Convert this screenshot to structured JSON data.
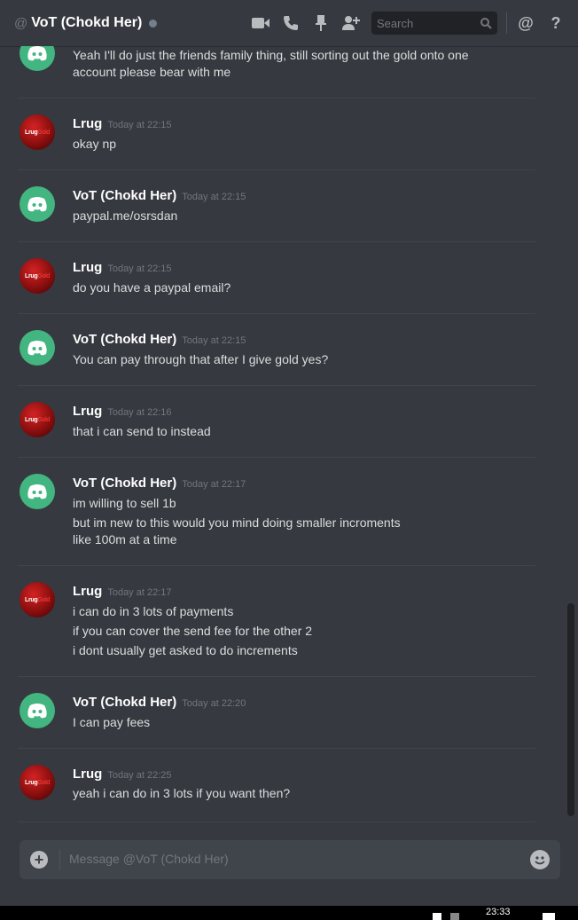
{
  "header": {
    "at_symbol": "@",
    "channel_name": "VoT (Chokd Her)",
    "search_placeholder": "Search",
    "icons": [
      "video-icon",
      "phone-icon",
      "pin-icon",
      "add-friend-icon",
      "search-icon",
      "mention-icon",
      "help-icon"
    ],
    "status_color": "#747f8d"
  },
  "messages": [
    {
      "author": "",
      "time": "",
      "avatar": "discord",
      "lines": [
        "Yeah I'll do just the friends family thing, still sorting out the gold onto one",
        "account please bear with me"
      ]
    },
    {
      "author": "Lrug",
      "time": "Today at 22:15",
      "avatar": "lrug",
      "lines": [
        "okay np"
      ]
    },
    {
      "author": "VoT (Chokd Her)",
      "time": "Today at 22:15",
      "avatar": "discord",
      "lines": [
        "paypal.me/osrsdan"
      ]
    },
    {
      "author": "Lrug",
      "time": "Today at 22:15",
      "avatar": "lrug",
      "lines": [
        "do you have a paypal email?"
      ]
    },
    {
      "author": "VoT (Chokd Her)",
      "time": "Today at 22:15",
      "avatar": "discord",
      "lines": [
        "You can pay through that after I give gold yes?"
      ]
    },
    {
      "author": "Lrug",
      "time": "Today at 22:16",
      "avatar": "lrug",
      "lines": [
        "that i can send to instead"
      ]
    },
    {
      "author": "VoT (Chokd Her)",
      "time": "Today at 22:17",
      "avatar": "discord",
      "lines": [
        "im willing to sell 1b",
        "but im new to this would you mind doing smaller incroments",
        "like 100m at a time"
      ]
    },
    {
      "author": "Lrug",
      "time": "Today at 22:17",
      "avatar": "lrug",
      "lines": [
        "i can do in 3 lots of payments",
        "if you can cover the send fee for the other 2",
        "i dont usually get asked to do increments"
      ]
    },
    {
      "author": "VoT (Chokd Her)",
      "time": "Today at 22:20",
      "avatar": "discord",
      "lines": [
        "I can pay fees"
      ]
    },
    {
      "author": "Lrug",
      "time": "Today at 22:25",
      "avatar": "lrug",
      "lines": [
        "yeah i can do in 3 lots if you want then?"
      ]
    }
  ],
  "avatar_labels": {
    "lrug_main": "Lrug",
    "lrug_accent": "Gold"
  },
  "composer": {
    "placeholder": "Message @VoT (Chokd Her)",
    "plus": "+"
  },
  "taskbar": {
    "clock": "23:33"
  },
  "colors": {
    "background": "#36393f",
    "discord_green": "#43b581",
    "lrug_red": "#c41a1a"
  }
}
